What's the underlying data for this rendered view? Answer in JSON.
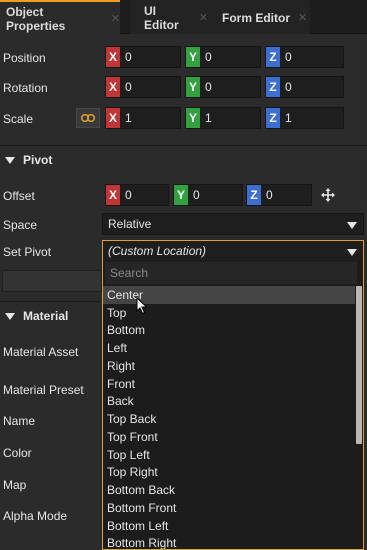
{
  "tabs": [
    {
      "label": "Object Properties",
      "active": true
    },
    {
      "label": "UI Editor",
      "active": false
    },
    {
      "label": "Form Editor",
      "active": false
    }
  ],
  "transform": {
    "position": {
      "label": "Position",
      "x": "0",
      "y": "0",
      "z": "0"
    },
    "rotation": {
      "label": "Rotation",
      "x": "0",
      "y": "0",
      "z": "0"
    },
    "scale": {
      "label": "Scale",
      "x": "1",
      "y": "1",
      "z": "1"
    }
  },
  "axes": {
    "x": "X",
    "y": "Y",
    "z": "Z"
  },
  "pivot": {
    "header": "Pivot",
    "offset": {
      "label": "Offset",
      "x": "0",
      "y": "0",
      "z": "0"
    },
    "space": {
      "label": "Space",
      "value": "Relative"
    },
    "set_pivot": {
      "label": "Set Pivot",
      "value": "(Custom Location)"
    }
  },
  "material": {
    "header": "Material",
    "fields": [
      "Material Asset",
      "Material Preset",
      "Name",
      "Color",
      "Map",
      "Alpha Mode"
    ]
  },
  "pivot_menu": {
    "search_placeholder": "Search",
    "hovered": "Center",
    "options": [
      "Center",
      "Top",
      "Bottom",
      "Left",
      "Right",
      "Front",
      "Back",
      "Top Back",
      "Top Front",
      "Top Left",
      "Top Right",
      "Bottom Back",
      "Bottom Front",
      "Bottom Left",
      "Bottom Right"
    ]
  },
  "icons": {
    "link": "link-icon",
    "move": "move-arrows-icon",
    "close": "close-icon",
    "collapse": "triangle-down-icon",
    "dropdown": "caret-down-icon",
    "cursor": "mouse-pointer-icon"
  },
  "colors": {
    "accent": "#f0a020",
    "axis_x": "#c03535",
    "axis_y": "#33a140",
    "axis_z": "#3c6fd1"
  }
}
